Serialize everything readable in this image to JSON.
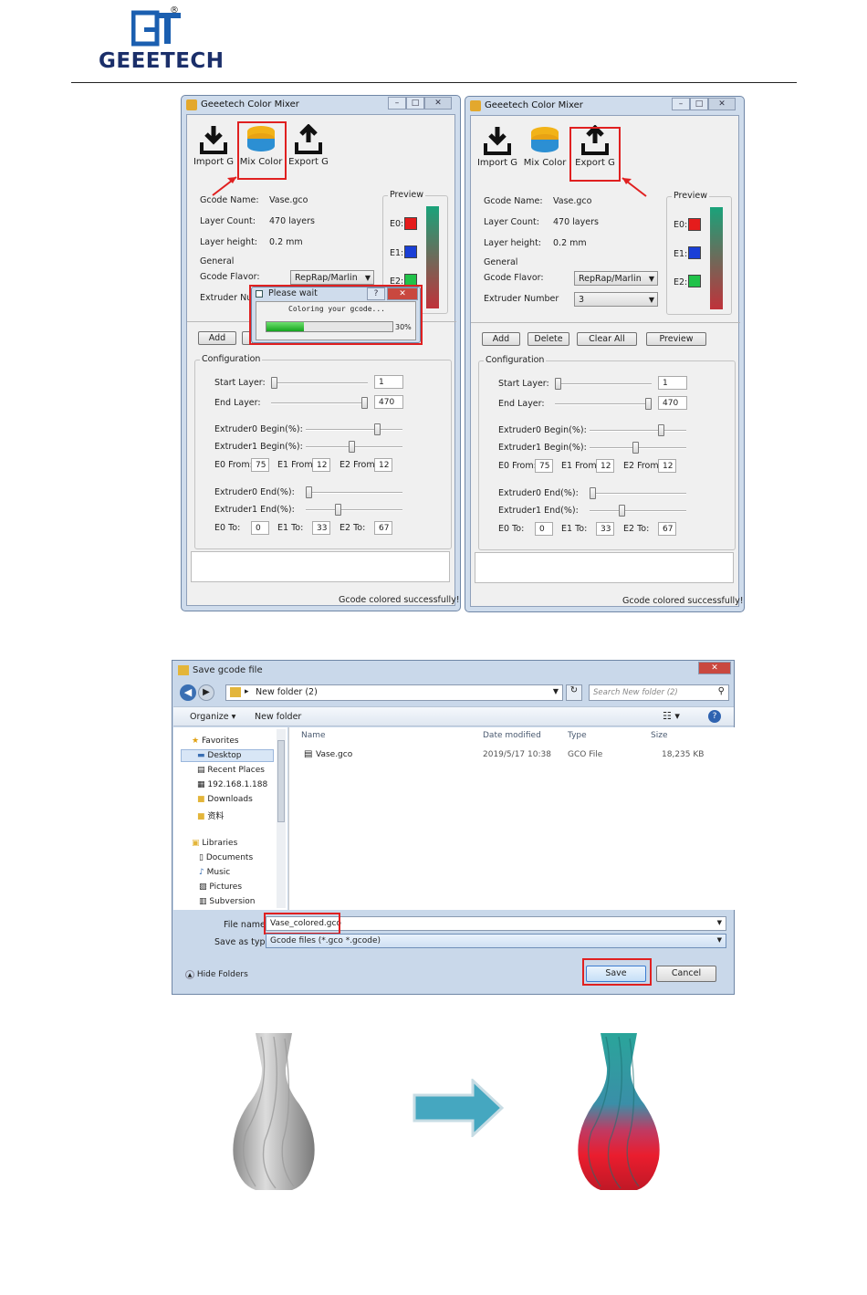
{
  "header": {
    "brand": "GEEETECH",
    "registered": "®"
  },
  "mixer_left": {
    "title": "Geeetech Color Mixer",
    "toolbar": {
      "import": "Import G",
      "mix": "Mix Color",
      "export": "Export G"
    },
    "fields": {
      "gcode_name_label": "Gcode Name:",
      "gcode_name": "Vase.gco",
      "layer_count_label": "Layer Count:",
      "layer_count": "470 layers",
      "layer_height_label": "Layer height:",
      "layer_height": "0.2 mm",
      "general": "General",
      "flavor_label": "Gcode Flavor:",
      "flavor": "RepRap/Marlin",
      "extruder_label": "Extruder Nu"
    },
    "preview": {
      "label": "Preview",
      "e0": "E0:",
      "e1": "E1:",
      "e2": "E2:"
    },
    "buttons": {
      "add": "Add"
    },
    "dialog": {
      "title": "Please wait",
      "message": "Coloring your gcode...",
      "percent": "30%",
      "progress": 0.3
    },
    "config": {
      "title": "Configuration",
      "start_label": "Start Layer:",
      "start": "1",
      "end_label": "End Layer:",
      "end": "470",
      "e0_begin": "Extruder0 Begin(%):",
      "e1_begin": "Extruder1 Begin(%):",
      "e0_from_label": "E0 From:",
      "e0_from": "75",
      "e1_from_label": "E1 From:",
      "e1_from": "12",
      "e2_from_label": "E2 From:",
      "e2_from": "12",
      "e0_end": "Extruder0 End(%):",
      "e1_end": "Extruder1 End(%):",
      "e0_to_label": "E0 To:",
      "e0_to": "0",
      "e1_to_label": "E1 To:",
      "e1_to": "33",
      "e2_to_label": "E2 To:",
      "e2_to": "67"
    },
    "status": "Gcode colored successfully!"
  },
  "mixer_right": {
    "title": "Geeetech Color Mixer",
    "toolbar": {
      "import": "Import G",
      "mix": "Mix Color",
      "export": "Export G"
    },
    "fields": {
      "gcode_name_label": "Gcode Name:",
      "gcode_name": "Vase.gco",
      "layer_count_label": "Layer Count:",
      "layer_count": "470 layers",
      "layer_height_label": "Layer height:",
      "layer_height": "0.2 mm",
      "general": "General",
      "flavor_label": "Gcode Flavor:",
      "flavor": "RepRap/Marlin",
      "extruder_label": "Extruder Number",
      "extruder": "3"
    },
    "preview": {
      "label": "Preview",
      "e0": "E0:",
      "e1": "E1:",
      "e2": "E2:"
    },
    "buttons": {
      "add": "Add",
      "delete": "Delete",
      "clear": "Clear All",
      "preview": "Preview"
    },
    "config": {
      "title": "Configuration",
      "start_label": "Start Layer:",
      "start": "1",
      "end_label": "End Layer:",
      "end": "470",
      "e0_begin": "Extruder0 Begin(%):",
      "e1_begin": "Extruder1 Begin(%):",
      "e0_from_label": "E0 From:",
      "e0_from": "75",
      "e1_from_label": "E1 From:",
      "e1_from": "12",
      "e2_from_label": "E2 From:",
      "e2_from": "12",
      "e0_end": "Extruder0 End(%):",
      "e1_end": "Extruder1 End(%):",
      "e0_to_label": "E0 To:",
      "e0_to": "0",
      "e1_to_label": "E1 To:",
      "e1_to": "33",
      "e2_to_label": "E2 To:",
      "e2_to": "67"
    },
    "status": "Gcode colored successfully!"
  },
  "save_dialog": {
    "title": "Save gcode file",
    "breadcrumb": "New folder (2)",
    "search_placeholder": "Search New folder (2)",
    "toolbar": {
      "organize": "Organize ▾",
      "new_folder": "New folder"
    },
    "nav": {
      "favorites": "Favorites",
      "desktop": "Desktop",
      "recent": "Recent Places",
      "ip": "192.168.1.188",
      "downloads": "Downloads",
      "ziliao": "资料",
      "libraries": "Libraries",
      "documents": "Documents",
      "music": "Music",
      "pictures": "Pictures",
      "subversion": "Subversion"
    },
    "columns": {
      "name": "Name",
      "date": "Date modified",
      "type": "Type",
      "size": "Size"
    },
    "file": {
      "name": "Vase.gco",
      "date": "2019/5/17 10:38",
      "type": "GCO File",
      "size": "18,235 KB"
    },
    "file_name_label": "File name:",
    "file_name": "Vase_colored.gco",
    "save_type_label": "Save as type:",
    "save_type": "Gcode files (*.gco *.gcode)",
    "save": "Save",
    "cancel": "Cancel",
    "hide_folders": "Hide Folders"
  },
  "colors": {
    "e0": "#e51c1c",
    "e1": "#1a3fd6",
    "e2": "#21c24a",
    "highlight": "#e02020"
  }
}
